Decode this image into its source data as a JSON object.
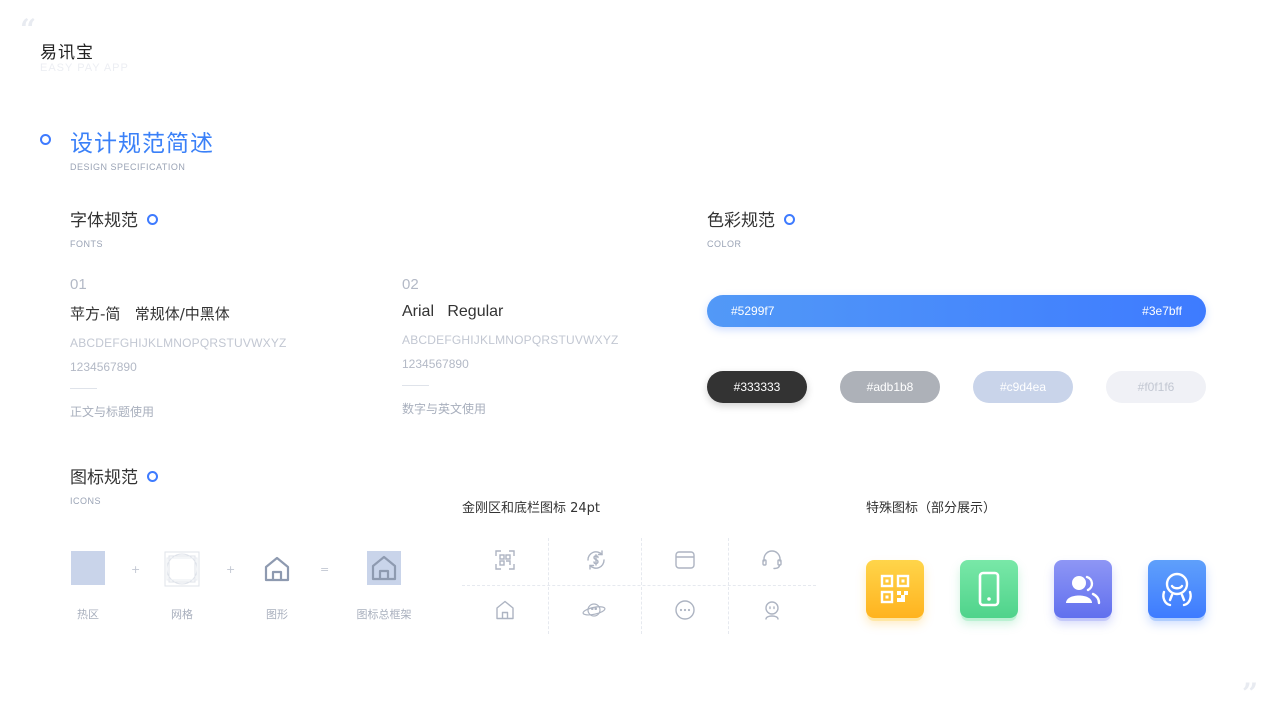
{
  "brand": {
    "name": "易讯宝",
    "subtitle": "EASY PAY APP"
  },
  "decor": {
    "open_quote": "“",
    "close_quote": "”"
  },
  "section": {
    "title": "设计规范简述",
    "subtitle": "DESIGN SPECIFICATION"
  },
  "fonts": {
    "title": "字体规范",
    "subtitle": "FONTS",
    "items": [
      {
        "num": "01",
        "name": "苹方-简   常规体/中黑体",
        "alphabet": "ABCDEFGHIJKLMNOPQRSTUVWXYZ",
        "digits": "1234567890",
        "usage": "正文与标题使用"
      },
      {
        "num": "02",
        "name": "Arial   Regular",
        "alphabet": "ABCDEFGHIJKLMNOPQRSTUVWXYZ",
        "digits": "1234567890",
        "usage": "数字与英文使用"
      }
    ]
  },
  "color": {
    "title": "色彩规范",
    "subtitle": "COLOR",
    "gradient": {
      "start": "#5299f7",
      "end": "#3e7bff"
    },
    "swatches": [
      {
        "hex": "#333333",
        "text_color": "#ffffff"
      },
      {
        "hex": "#adb1b8",
        "text_color": "#ffffff"
      },
      {
        "hex": "#c9d4ea",
        "text_color": "#ffffff"
      },
      {
        "hex": "#f0f1f6",
        "text_color": "#c2c7d2"
      }
    ]
  },
  "icons": {
    "title": "图标规范",
    "subtitle": "ICONS",
    "construct": {
      "hotzone": "热区",
      "grid": "网格",
      "shape": "图形",
      "frame": "图标总框架",
      "plus": "+",
      "equals": "="
    },
    "grid_section_title": "金刚区和底栏图标 24pt",
    "grid_icons": [
      "scan-icon",
      "dollar-exchange-icon",
      "wallet-icon",
      "headset-icon",
      "home-icon",
      "planet-icon",
      "message-icon",
      "user-icon"
    ],
    "special_title": "特殊图标（部分展示）",
    "special_icons": [
      {
        "name": "qr-code-icon",
        "color_top": "#ffd54a",
        "color_bottom": "#ffb31f"
      },
      {
        "name": "phone-icon",
        "color_top": "#79e8a8",
        "color_bottom": "#4fd38b"
      },
      {
        "name": "contacts-icon",
        "color_top": "#8e96f5",
        "color_bottom": "#6170ee"
      },
      {
        "name": "service-person-icon",
        "color_top": "#5fa0fb",
        "color_bottom": "#3e7bff"
      }
    ]
  }
}
